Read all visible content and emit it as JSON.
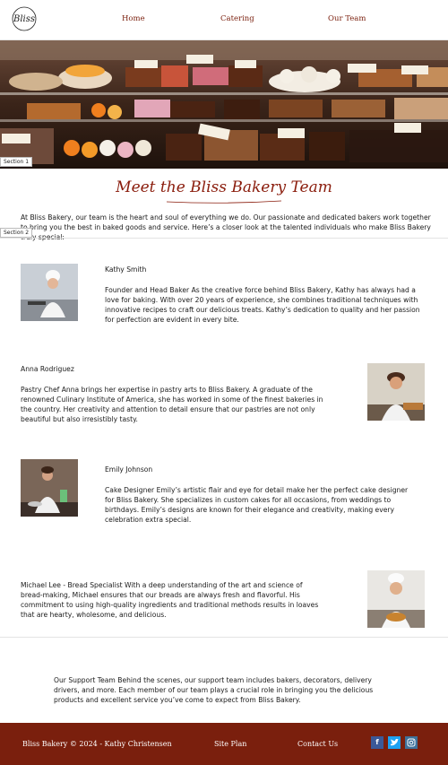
{
  "header": {
    "logo_text": "Bliss",
    "nav": [
      "Home",
      "Catering",
      "Our Team"
    ]
  },
  "hero": {
    "section_label": "Section 1",
    "image_alt": "bakery display case with cakes and pastries"
  },
  "intro": {
    "title": "Meet the Bliss Bakery Team",
    "text": "At Bliss Bakery, our team is the heart and soul of everything we do. Our passionate and dedicated bakers work together to bring you the best in baked goods and service. Here’s a closer look at the talented individuals who make Bliss Bakery truly special:",
    "section_label": "Section 2"
  },
  "team": [
    {
      "name": "Kathy Smith",
      "bio": "Founder and Head Baker As the creative force behind Bliss Bakery, Kathy has always had a love for baking. With over 20 years of experience, she combines traditional techniques with innovative recipes to craft our delicious treats. Kathy’s dedication to quality and her passion for perfection are evident in every bite."
    },
    {
      "name": "Anna Rodriguez",
      "bio": "Pastry Chef Anna brings her expertise in pastry arts to Bliss Bakery. A graduate of the renowned Culinary Institute of America, she has worked in some of the finest bakeries in the country. Her creativity and attention to detail ensure that our pastries are not only beautiful but also irresistibly tasty."
    },
    {
      "name": "Emily Johnson",
      "bio": "Cake Designer Emily’s artistic flair and eye for detail make her the perfect cake designer for Bliss Bakery. She specializes in custom cakes for all occasions, from weddings to birthdays. Emily’s designs are known for their elegance and creativity, making every celebration extra special."
    },
    {
      "name": "",
      "bio": "Michael Lee - Bread Specialist With a deep understanding of the art and science of bread-making, Michael ensures that our breads are always fresh and flavorful. His commitment to using high-quality ingredients and traditional methods results in loaves that are hearty, wholesome, and delicious."
    }
  ],
  "support": {
    "text": "Our Support Team Behind the scenes, our support team includes bakers, decorators, delivery drivers, and more. Each member of our team plays a crucial role in bringing you the delicious products and excellent service you’ve come to expect from Bliss Bakery."
  },
  "footer": {
    "copyright": "Bliss Bakery © 2024 - Kathy Christensen",
    "site_plan": "Site Plan",
    "contact": "Contact Us",
    "social": [
      {
        "icon": "facebook-icon",
        "glyph": "f"
      },
      {
        "icon": "twitter-icon",
        "glyph": "t"
      },
      {
        "icon": "instagram-icon",
        "glyph": "◘"
      }
    ]
  },
  "colors": {
    "brand": "#7a1f0d",
    "title": "#8a1c0c",
    "facebook": "#3b5998",
    "twitter": "#1da1f2",
    "instagram": "#3f729b"
  }
}
